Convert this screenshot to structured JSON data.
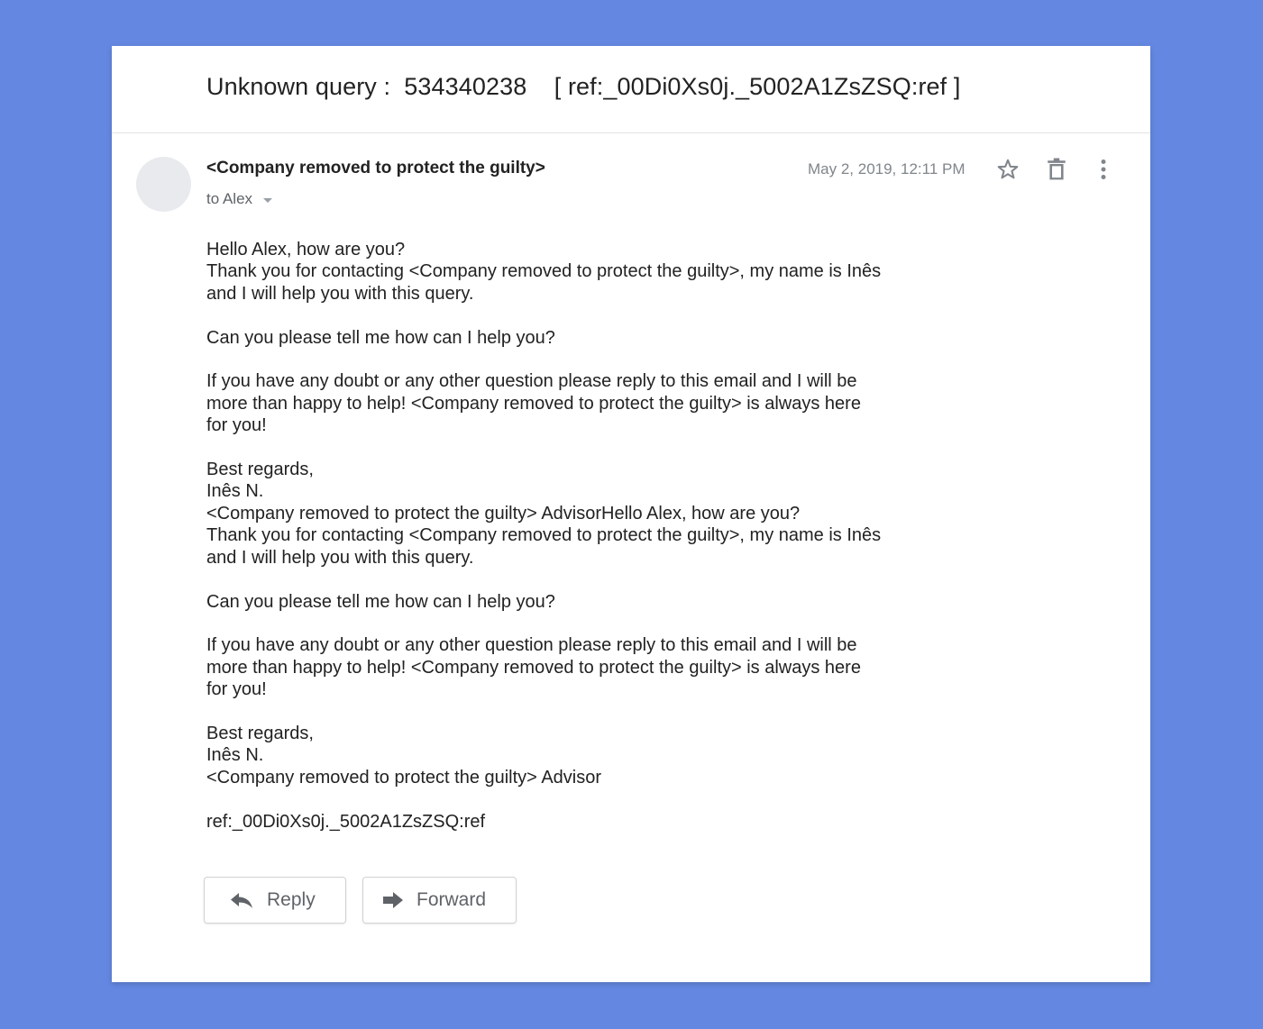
{
  "subject": "Unknown query :  534340238    [ ref:_00Di0Xs0j._5002A1ZsZSQ:ref ]",
  "sender": "<Company removed to protect the guilty>",
  "recipient": "to Alex",
  "timestamp": "May 2, 2019, 12:11 PM",
  "icons": {
    "avatar": "avatar-placeholder",
    "star": "star-outline-icon",
    "trash": "trash-icon",
    "more": "more-vert-icon",
    "recipient_details": "chevron-down-icon",
    "reply": "reply-arrow-icon",
    "forward": "forward-arrow-icon"
  },
  "body": "Hello Alex, how are you?\nThank you for contacting <Company removed to protect the guilty>, my name is Inês\nand I will help you with this query.\n\nCan you please tell me how can I help you?\n\nIf you have any doubt or any other question please reply to this email and I will be\nmore than happy to help! <Company removed to protect the guilty> is always here\nfor you!\n\nBest regards,\nInês N.\n<Company removed to protect the guilty> AdvisorHello Alex, how are you?\nThank you for contacting <Company removed to protect the guilty>, my name is Inês\nand I will help you with this query.\n\nCan you please tell me how can I help you?\n\nIf you have any doubt or any other question please reply to this email and I will be\nmore than happy to help! <Company removed to protect the guilty> is always here\nfor you!\n\nBest regards,\nInês N.\n<Company removed to protect the guilty> Advisor\n\nref:_00Di0Xs0j._5002A1ZsZSQ:ref",
  "actions": {
    "reply_label": "Reply",
    "forward_label": "Forward"
  },
  "colors": {
    "background": "#6488e2",
    "card": "#ffffff",
    "icon": "#80868b"
  }
}
